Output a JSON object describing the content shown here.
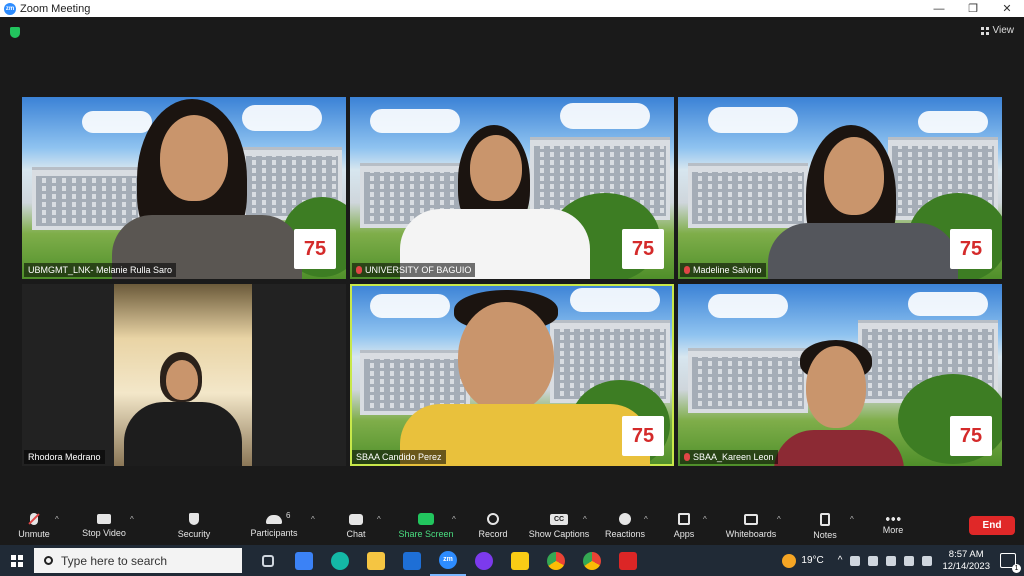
{
  "window": {
    "title": "Zoom Meeting",
    "app_badge": "zm"
  },
  "top_right": {
    "view_label": "View"
  },
  "participants": [
    {
      "name": "UBMGMT_LNK- Melanie Rulla Saro",
      "muted": false
    },
    {
      "name": "UNIVERSITY OF BAGUIO",
      "muted": true
    },
    {
      "name": "Madeline Salvino",
      "muted": true
    },
    {
      "name": "Rhodora Medrano",
      "muted": false
    },
    {
      "name": "SBAA Candido Perez",
      "muted": false
    },
    {
      "name": "SBAA_Kareen Leon",
      "muted": true
    }
  ],
  "logo_text": "75",
  "toolbar": {
    "unmute": "Unmute",
    "stop_video": "Stop Video",
    "security": "Security",
    "participants": "Participants",
    "participants_count": "6",
    "chat": "Chat",
    "share_screen": "Share Screen",
    "record": "Record",
    "show_captions": "Show Captions",
    "cc": "CC",
    "reactions": "Reactions",
    "apps": "Apps",
    "whiteboards": "Whiteboards",
    "notes": "Notes",
    "more": "More",
    "end": "End"
  },
  "taskbar": {
    "search_placeholder": "Type here to search",
    "zoom_badge": "zm",
    "weather": "19°C",
    "time": "8:57 AM",
    "date": "12/14/2023"
  },
  "colors": {
    "accent_green": "#22c55e",
    "end_red": "#e02828",
    "active_speaker": "#c8e84a"
  }
}
